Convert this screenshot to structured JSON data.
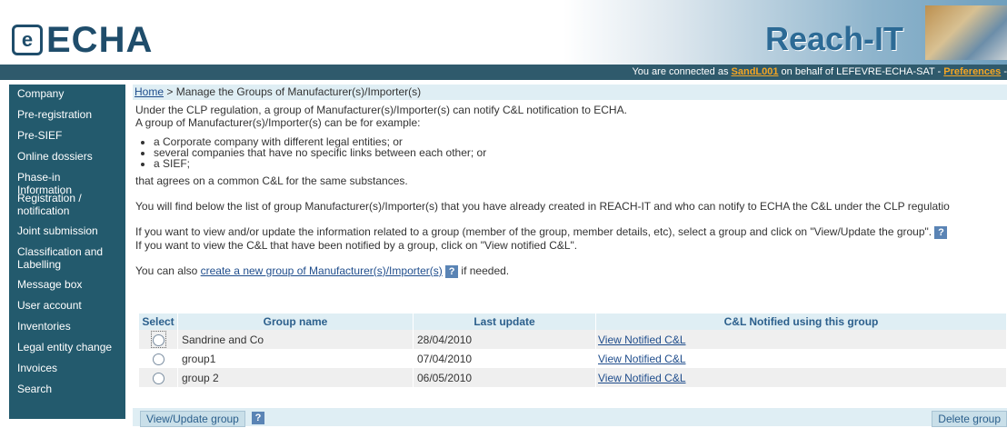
{
  "header": {
    "logo_text": "ECHA",
    "app_title": "Reach-IT",
    "conn_prefix": "You are connected as ",
    "conn_user": "SandL001",
    "conn_middle": " on behalf of LEFEVRE-ECHA-SAT - ",
    "conn_prefs": "Preferences",
    "conn_suffix": " -"
  },
  "sidebar": {
    "items": [
      {
        "label": "Company"
      },
      {
        "label": "Pre-registration"
      },
      {
        "label": "Pre-SIEF"
      },
      {
        "label": "Online dossiers"
      },
      {
        "label": "Phase-in Information"
      },
      {
        "label": "Registration / notification"
      },
      {
        "label": "Joint submission"
      },
      {
        "label": "Classification and Labelling"
      },
      {
        "label": "Message box"
      },
      {
        "label": "User account"
      },
      {
        "label": "Inventories"
      },
      {
        "label": "Legal entity change"
      },
      {
        "label": "Invoices"
      },
      {
        "label": "Search"
      }
    ]
  },
  "breadcrumb": {
    "home": "Home",
    "current": " > Manage the Groups of Manufacturer(s)/Importer(s)"
  },
  "content": {
    "intro1": "Under the CLP regulation, a group of Manufacturer(s)/Importer(s) can notify C&L notification to ECHA.",
    "intro2": "A group of Manufacturer(s)/Importer(s) can be for example:",
    "bullets": [
      "a Corporate company with different legal entities; or",
      "several companies that have no specific links between each other; or",
      "a SIEF;"
    ],
    "agrees": "that agrees on a common C&L for the same substances.",
    "list_text": "You will find below the list of group Manufacturer(s)/Importer(s) that you have already created in REACH-IT and who can notify to ECHA the C&L under the CLP regulatio",
    "view_text": "If you want to view and/or update the information related to a group (member of the group, member details, etc), select a group and click on \"View/Update the group\".",
    "notified_text": "If you want to view the C&L that have been notified by a group, click on \"View notified C&L\".",
    "create_prefix": "You can also ",
    "create_link": "create a new group of Manufacturer(s)/Importer(s)",
    "create_suffix": " if needed.",
    "help_glyph": "?"
  },
  "table": {
    "headers": [
      "Select",
      "Group name",
      "Last update",
      "C&L Notified using this group"
    ],
    "rows": [
      {
        "name": "Sandrine and Co",
        "date": "28/04/2010",
        "link": "View Notified C&L"
      },
      {
        "name": "group1",
        "date": "07/04/2010",
        "link": "View Notified C&L"
      },
      {
        "name": "group 2",
        "date": "06/05/2010",
        "link": "View Notified C&L"
      }
    ]
  },
  "footer": {
    "view_update_label": "View/Update group",
    "delete_label": "Delete group",
    "help_glyph": "?"
  }
}
